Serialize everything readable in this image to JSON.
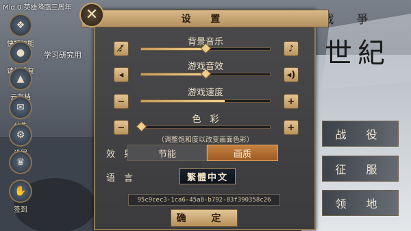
{
  "top_left_text": "Mid.0 英雄降臨三周年",
  "side_menu": [
    {
      "label": "快捷功能",
      "icon": "gift-icon"
    },
    {
      "label": "请勿重复",
      "icon": "pig-icon"
    },
    {
      "label": "云存档",
      "icon": "upload-icon"
    },
    {
      "label": "公告",
      "icon": "mail-icon"
    },
    {
      "label": "设置",
      "icon": "gear-icon"
    },
    {
      "label": "",
      "icon": "crown-icon"
    },
    {
      "label": "签到",
      "icon": "hand-icon"
    }
  ],
  "study_text": "学习研究用",
  "title": {
    "small": "戰 爭",
    "big": "世紀"
  },
  "main_buttons": [
    "战 役",
    "征 服",
    "领 地"
  ],
  "settings": {
    "header": "设 置",
    "close": "✕",
    "bgm": {
      "label": "背景音乐",
      "level": 0.5
    },
    "sfx": {
      "label": "游戏音效",
      "level": 0.5
    },
    "speed": {
      "label": "游戏速度",
      "level": 0.65
    },
    "color": {
      "label": "色　彩",
      "level": 0.0
    },
    "color_hint": "（调整饱和度以改变画面色彩）",
    "effect_label": "效　果",
    "effect_options": [
      "节能",
      "画质"
    ],
    "effect_selected": "画质",
    "language_label": "语　言",
    "language_value": "繁體中文",
    "uuid": "95c9cec3-1ca6-45a8-b792-83f390358c26",
    "confirm": "确 定"
  }
}
